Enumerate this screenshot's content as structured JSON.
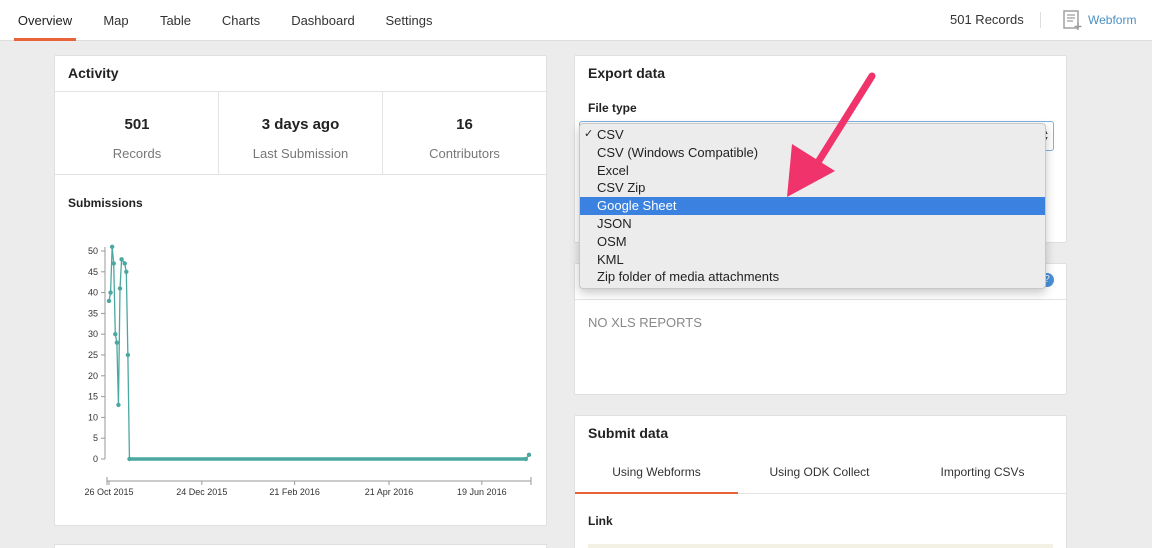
{
  "nav": {
    "tabs": [
      "Overview",
      "Map",
      "Table",
      "Charts",
      "Dashboard",
      "Settings"
    ],
    "active_tab": "Overview",
    "records_count": "501 Records",
    "webform_label": "Webform"
  },
  "activity": {
    "title": "Activity",
    "stats": [
      {
        "value": "501",
        "label": "Records"
      },
      {
        "value": "3 days ago",
        "label": "Last Submission"
      },
      {
        "value": "16",
        "label": "Contributors"
      }
    ],
    "submissions_title": "Submissions"
  },
  "export": {
    "title": "Export data",
    "file_type_label": "File type",
    "selected": "CSV",
    "highlighted": "Google Sheet",
    "options": [
      "CSV",
      "CSV (Windows Compatible)",
      "Excel",
      "CSV Zip",
      "Google Sheet",
      "JSON",
      "OSM",
      "KML",
      "Zip folder of media attachments"
    ]
  },
  "xls_reports": {
    "info_icon": "?",
    "empty_text": "NO XLS REPORTS"
  },
  "submit": {
    "title": "Submit data",
    "tabs": [
      "Using Webforms",
      "Using ODK Collect",
      "Importing CSVs"
    ],
    "active_tab": "Using Webforms",
    "link_label": "Link"
  },
  "colors": {
    "accent": "#e8623a",
    "link": "#4a90c2",
    "highlight": "#3b82e0",
    "line": "#4ba8a0",
    "arrow": "#f0336b"
  },
  "chart_data": {
    "type": "line",
    "title": "Submissions",
    "ylim": [
      0,
      50
    ],
    "yticks": [
      0,
      5,
      10,
      15,
      20,
      25,
      30,
      35,
      40,
      45,
      50
    ],
    "xtick_labels": [
      "26 Oct 2015",
      "24 Dec 2015",
      "21 Feb 2016",
      "21 Apr 2016",
      "19 Jun 2016"
    ],
    "xtick_days": [
      0,
      59,
      118,
      178,
      237
    ],
    "x_day_range": [
      0,
      267
    ],
    "series": [
      {
        "points": [
          [
            0,
            38
          ],
          [
            1,
            40
          ],
          [
            2,
            51
          ],
          [
            3,
            47
          ],
          [
            4,
            30
          ],
          [
            5,
            28
          ],
          [
            6,
            13
          ],
          [
            7,
            41
          ],
          [
            8,
            48
          ],
          [
            10,
            47
          ],
          [
            11,
            45
          ],
          [
            12,
            25
          ],
          [
            13,
            0
          ],
          [
            265,
            0
          ],
          [
            267,
            1
          ]
        ]
      }
    ]
  }
}
